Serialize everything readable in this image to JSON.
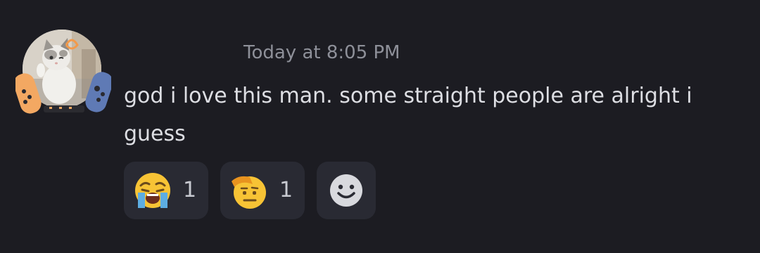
{
  "message": {
    "timestamp": "Today at 8:05 PM",
    "content": "god i love this man. some straight people are alright i guess"
  },
  "avatar": {
    "description_icon": "cat-avatar-with-game-controller-decoration"
  },
  "reactions": [
    {
      "emoji_icon": "crying-face-icon",
      "count": "1"
    },
    {
      "emoji_icon": "saluting-face-icon",
      "count": "1"
    }
  ],
  "add_reaction": {
    "icon": "smiley-add-reaction-icon"
  },
  "colors": {
    "background": "#1c1c22",
    "reaction_bg": "#292a33",
    "timestamp": "#8e9099",
    "text": "#dddee3"
  }
}
